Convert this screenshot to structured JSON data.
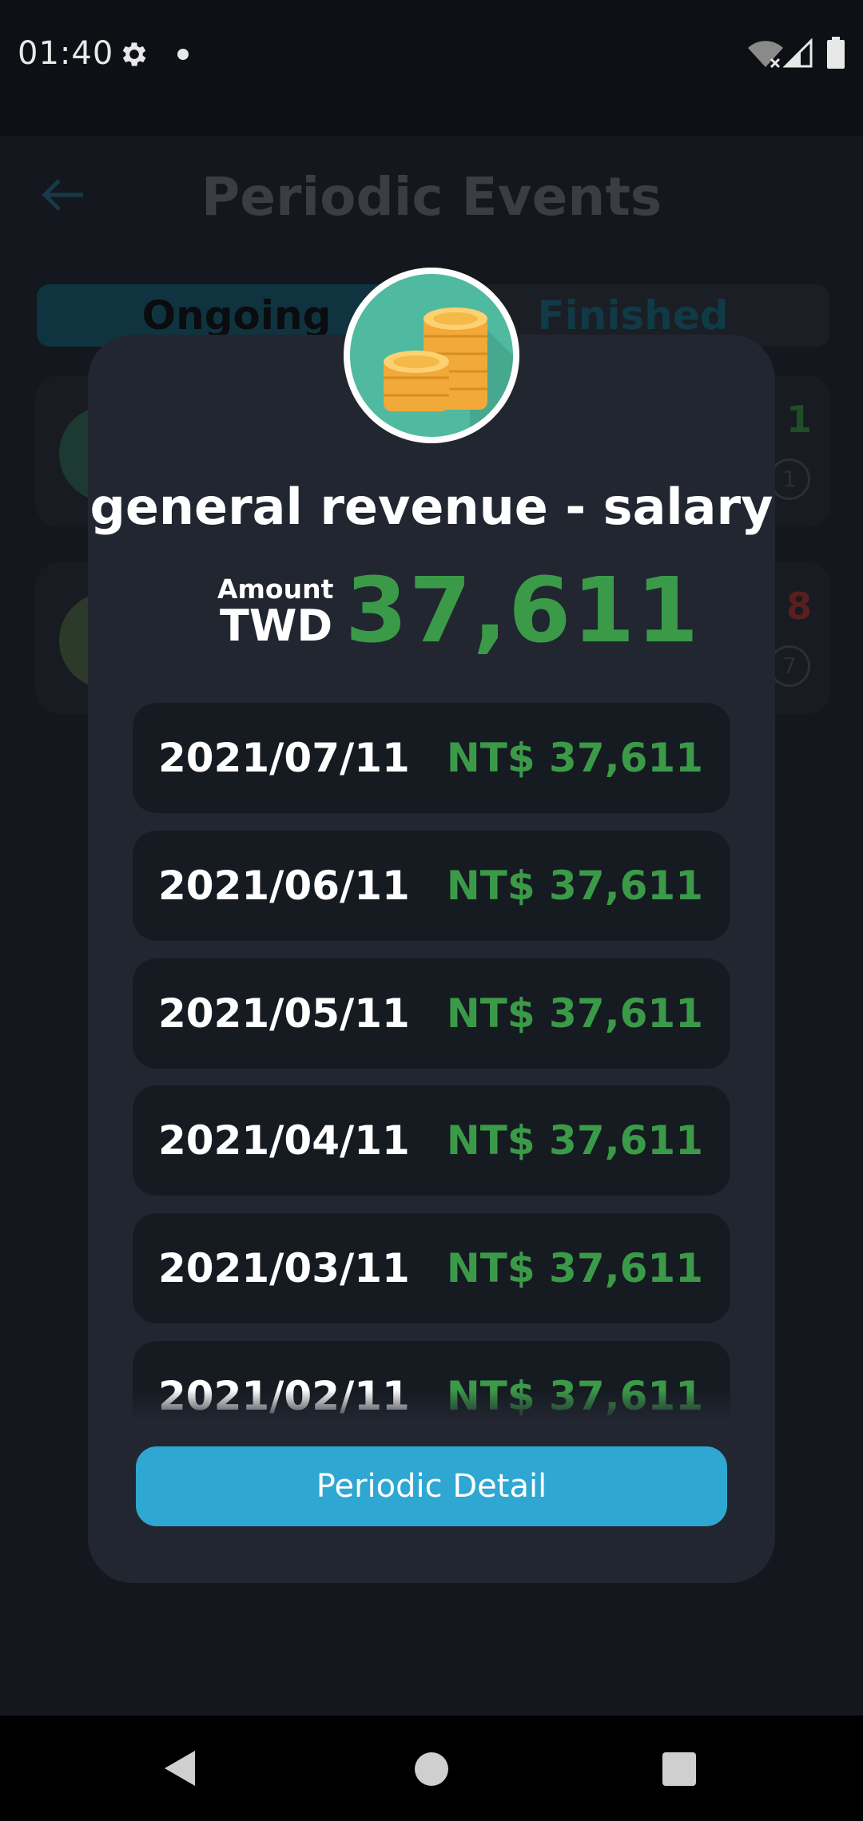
{
  "status_bar": {
    "time": "01:40",
    "icons": [
      "gear-icon",
      "dot-icon",
      "wifi-off-icon",
      "cell-signal-icon",
      "battery-icon"
    ]
  },
  "background_page": {
    "title": "Periodic Events",
    "tabs": [
      {
        "label": "Ongoing",
        "selected": true
      },
      {
        "label": "Finished",
        "selected": false
      }
    ],
    "cards": [
      {
        "amount": "1",
        "badge": "1",
        "amount_color": "#1f4d26"
      },
      {
        "amount": "8",
        "badge": "7",
        "amount_color": "#5a1e1e"
      }
    ]
  },
  "modal": {
    "icon": "coins-icon",
    "title": "general revenue -  salary",
    "amount_label": "Amount",
    "currency": "TWD",
    "amount": "37,611",
    "records": [
      {
        "date": "2021/07/11",
        "amount": "NT$ 37,611"
      },
      {
        "date": "2021/06/11",
        "amount": "NT$ 37,611"
      },
      {
        "date": "2021/05/11",
        "amount": "NT$ 37,611"
      },
      {
        "date": "2021/04/11",
        "amount": "NT$ 37,611"
      },
      {
        "date": "2021/03/11",
        "amount": "NT$ 37,611"
      },
      {
        "date": "2021/02/11",
        "amount": "NT$ 37,611"
      }
    ],
    "button_label": "Periodic Detail"
  },
  "colors": {
    "accent": "#2ea7d2",
    "positive": "#3b9a48",
    "modal_bg": "#222631",
    "record_bg": "#161a21"
  },
  "nav_bar": {
    "icons": [
      "back-icon",
      "home-icon",
      "recents-icon"
    ]
  }
}
